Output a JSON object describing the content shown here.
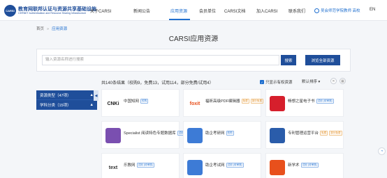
{
  "header": {
    "logo_text": "CARSI",
    "brand_cn": "教育网联邦认证与资源共享基础设施",
    "brand_en": "CERNET Authentication and Resource Sharing Infrastructure",
    "nav": [
      "关于CARSI",
      "新闻公告",
      "应用资源",
      "会员单位",
      "CARSI文档",
      "加入CARSI",
      "联系我们"
    ],
    "user": "吴会师范学院教师 高校",
    "lang": "EN"
  },
  "breadcrumb": {
    "home": "首页",
    "separator": "»",
    "current": "应用资源"
  },
  "page_title": "CARSI应用资源",
  "search": {
    "placeholder": "输入资源名称进行搜索",
    "button": "搜索",
    "browse_all": "浏览全部资源"
  },
  "results": {
    "summary": "共140条结果（校购9，免费13，试用114，部分免费/试用4）",
    "only_available": "只显示有权资源",
    "sort": "默认排序 ▾"
  },
  "filters": [
    {
      "label": "资源类型（47项）",
      "arrow": "▲"
    },
    {
      "label": "学科分类（15项）",
      "arrow": "▲"
    }
  ],
  "collapse_arrow": "◀",
  "cards": [
    {
      "icon_text": "CNKi",
      "icon_color": "#1a1a1a",
      "name": "中国知网",
      "badges": [
        {
          "text": "校购",
          "color": "blue"
        }
      ]
    },
    {
      "icon_text": "foxit",
      "icon_color": "#e8501c",
      "name": "福昕高级PDF编辑器",
      "badges": [
        {
          "text": "免费",
          "color": "orange"
        },
        {
          "text": "部分免费",
          "color": "orange"
        }
      ]
    },
    {
      "icon_text": "",
      "icon_color": "#d61f2c",
      "name": "畅想之星电子书",
      "badges": [
        {
          "text": "试用 (待审核)",
          "color": "blue"
        }
      ]
    },
    {
      "icon_text": "",
      "icon_color": "#7a4fb0",
      "name": "Specialist 阅读特色专题数据库",
      "badges": [
        {
          "text": "试用 (待审核)",
          "color": "blue"
        }
      ]
    },
    {
      "icon_text": "",
      "icon_color": "#3d7bd6",
      "name": "助企考研网",
      "badges": [
        {
          "text": "校购",
          "color": "blue"
        }
      ]
    },
    {
      "icon_text": "",
      "icon_color": "#2a5caa",
      "name": "专利管理运营平台",
      "badges": [
        {
          "text": "免费",
          "color": "orange"
        },
        {
          "text": "部分免费",
          "color": "orange"
        }
      ]
    },
    {
      "icon_text": "text",
      "icon_color": "#333333",
      "name": "乐教网",
      "badges": [
        {
          "text": "试用 (待审核)",
          "color": "blue"
        }
      ]
    },
    {
      "icon_text": "",
      "icon_color": "#3d7bd6",
      "name": "助企考试网",
      "badges": [
        {
          "text": "试用 (待审核)",
          "color": "blue"
        }
      ]
    },
    {
      "icon_text": "",
      "icon_color": "#e8501c",
      "name": "新学术",
      "badges": [
        {
          "text": "试用 (待审核)",
          "color": "blue"
        }
      ]
    }
  ]
}
